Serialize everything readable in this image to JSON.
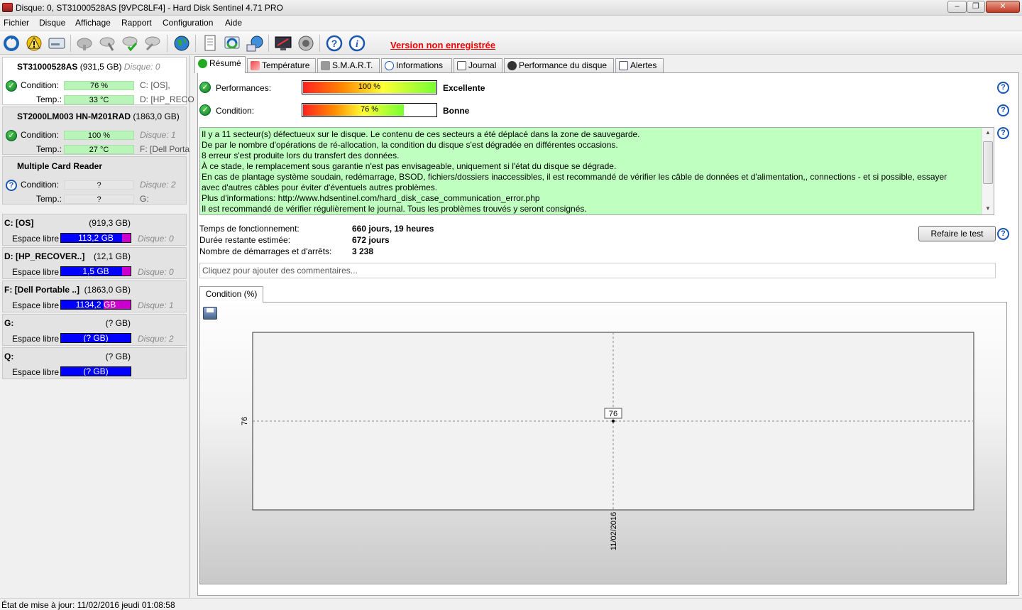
{
  "window": {
    "title": "Disque: 0, ST31000528AS [9VPC8LF4]  -  Hard Disk Sentinel 4.71 PRO",
    "minimize": "–",
    "maximize": "❐",
    "close": "✕"
  },
  "menu": [
    "Fichier",
    "Disque",
    "Affichage",
    "Rapport",
    "Configuration",
    "Aide"
  ],
  "toolbar": {
    "version_link": "Version non enregistrée",
    "icons": [
      "refresh-icon",
      "alert-icon",
      "disk-icon",
      "disk-gray-icon",
      "disk-tool-icon",
      "disk-check-icon",
      "disk-wrench-icon",
      "globe-icon",
      "report-icon",
      "sync-icon",
      "network-icon",
      "monitor-icon",
      "sound-icon",
      "help-icon",
      "info-icon"
    ]
  },
  "disks": [
    {
      "name": "ST31000528AS",
      "size": "(931,5 GB)",
      "disk_id": "Disque: 0",
      "condition_label": "Condition:",
      "condition": "76 %",
      "temp_label": "Temp.:",
      "temp": "33 °C",
      "vol1": "C: [OS],",
      "vol2": "D: [HP_RECO"
    },
    {
      "name": "ST2000LM003 HN-M201RAD",
      "size": "(1863,0 GB)",
      "disk_id": "Disque: 1",
      "condition_label": "Condition:",
      "condition": "100 %",
      "temp_label": "Temp.:",
      "temp": "27 °C",
      "vol1": "F: [Dell Porta"
    },
    {
      "name": "Multiple Card  Reader",
      "disk_id": "Disque: 2",
      "condition_label": "Condition:",
      "condition": "?",
      "temp_label": "Temp.:",
      "temp": "?",
      "vol1": "G:"
    }
  ],
  "volumes": [
    {
      "name": "C: [OS]",
      "size": "(919,3 GB)",
      "free_label": "Espace libre",
      "free": "113,2 GB",
      "used_pct": 12,
      "disk": "Disque: 0"
    },
    {
      "name": "D: [HP_RECOVER..]",
      "size": "(12,1 GB)",
      "free_label": "Espace libre",
      "free": "1,5 GB",
      "used_pct": 12,
      "disk": "Disque: 0"
    },
    {
      "name": "F: [Dell Portable ..]",
      "size": "(1863,0 GB)",
      "free_label": "Espace libre",
      "free": "1134,2 GB",
      "used_pct": 39,
      "disk": "Disque: 1"
    },
    {
      "name": "G:",
      "size": "(? GB)",
      "free_label": "Espace libre",
      "free": "(? GB)",
      "used_pct": 0,
      "disk": "Disque: 2"
    },
    {
      "name": "Q:",
      "size": "(? GB)",
      "free_label": "Espace libre",
      "free": "(? GB)",
      "used_pct": 0,
      "disk": ""
    }
  ],
  "tabs": [
    "Résumé",
    "Température",
    "S.M.A.R.T.",
    "Informations",
    "Journal",
    "Performance du disque",
    "Alertes"
  ],
  "summary": {
    "performance_label": "Performances:",
    "performance_value": 100,
    "performance_text": "100 %",
    "performance_rating": "Excellente",
    "condition_label": "Condition:",
    "condition_value": 76,
    "condition_text": "76 %",
    "condition_rating": "Bonne",
    "message_lines": [
      "Il y a 11 secteur(s) défectueux sur le disque. Le contenu de ces secteurs a été déplacé dans la zone de sauvegarde.",
      "De par le nombre d'opérations de ré-allocation, la condition du disque s'est dégradée en différentes occasions.",
      "8 erreur s'est produite lors du transfert des données.",
      "À ce stade, le remplacement sous garantie n'est pas envisageable, uniquement si l'état du disque se dégrade.",
      "En cas de plantage système soudain, redémarrage, BSOD, fichiers/dossiers inaccessibles, il est recommandé de vérifier les câble de données et d'alimentation,, connections - et si possible, essayer",
      "avec d'autres câbles pour éviter d'éventuels autres problèmes.",
      "Plus d'informations: http://www.hdsentinel.com/hard_disk_case_communication_error.php",
      "Il est recommandé de vérifier régulièrement le journal. Tous les problèmes trouvés y seront consignés."
    ],
    "uptime_label": "Temps de fonctionnement:",
    "uptime": "660 jours, 19 heures",
    "remaining_label": "Durée restante estimée:",
    "remaining": "672 jours",
    "starts_label": "Nombre de démarrages et d'arrêts:",
    "starts": "3 238",
    "retest_button": "Refaire le test",
    "comment_placeholder": "Cliquez pour ajouter des commentaires..."
  },
  "chart_tab": "Condition (%)",
  "chart_data": {
    "type": "line",
    "x": [
      "11/02/2016"
    ],
    "series": [
      {
        "values": [
          76
        ]
      }
    ],
    "yticks": [
      "76"
    ],
    "xticks": [
      "11/02/2016"
    ],
    "data_labels": [
      "76"
    ],
    "grid": true
  },
  "status": "État de mise à jour: 11/02/2016 jeudi 01:08:58",
  "colors": {
    "ok_green": "#b9f5b9",
    "message_bg": "#bfffbf",
    "free_space": "#0000ff",
    "used_space": "#cc00cc",
    "link_red": "#ee0000"
  }
}
